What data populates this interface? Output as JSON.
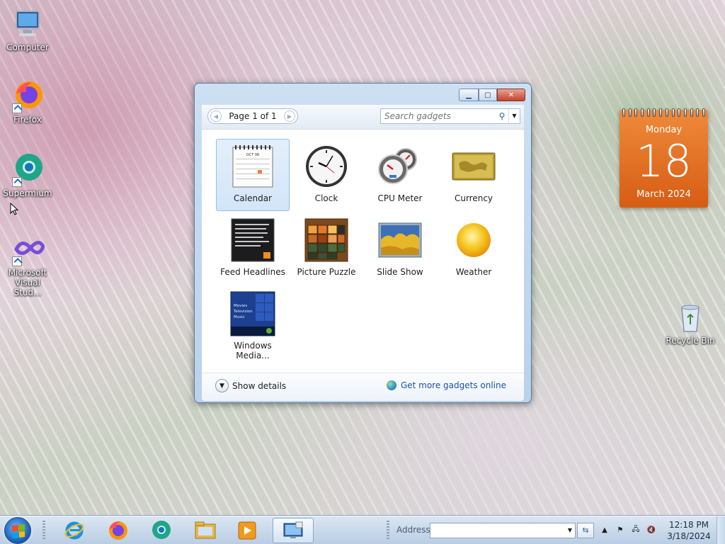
{
  "desktop": {
    "icons": [
      {
        "label": "Computer",
        "icon": "computer-icon"
      },
      {
        "label": "Firefox",
        "icon": "firefox-icon"
      },
      {
        "label": "Supermium",
        "icon": "supermium-icon"
      },
      {
        "label": "Microsoft Visual Stud...",
        "icon": "visual-studio-icon"
      },
      {
        "label": "Recycle Bin",
        "icon": "recycle-bin-icon"
      }
    ]
  },
  "calendar_gadget": {
    "weekday": "Monday",
    "day": "18",
    "month_year": "March 2024",
    "color": "#e06b1f"
  },
  "gadget_window": {
    "pager": "Page 1 of 1",
    "search_placeholder": "Search gadgets",
    "gadgets": [
      {
        "label": "Calendar",
        "icon": "calendar-icon",
        "selected": true
      },
      {
        "label": "Clock",
        "icon": "clock-icon"
      },
      {
        "label": "CPU Meter",
        "icon": "cpu-meter-icon"
      },
      {
        "label": "Currency",
        "icon": "currency-icon"
      },
      {
        "label": "Feed Headlines",
        "icon": "feed-headlines-icon"
      },
      {
        "label": "Picture Puzzle",
        "icon": "picture-puzzle-icon"
      },
      {
        "label": "Slide Show",
        "icon": "slide-show-icon"
      },
      {
        "label": "Weather",
        "icon": "weather-icon"
      },
      {
        "label": "Windows Media...",
        "icon": "windows-media-center-icon"
      }
    ],
    "calendar_thumb_month": "OCT 06",
    "media_thumb_lines": [
      "Movies",
      "Television",
      "Music"
    ],
    "show_details": "Show details",
    "get_more": "Get more gadgets online"
  },
  "taskbar": {
    "address_label": "Address",
    "address_value": "",
    "time": "12:18 PM",
    "date": "3/18/2024",
    "pinned": [
      "internet-explorer-icon",
      "firefox-icon",
      "supermium-icon",
      "file-explorer-icon",
      "media-player-icon",
      "gadgets-icon"
    ]
  }
}
